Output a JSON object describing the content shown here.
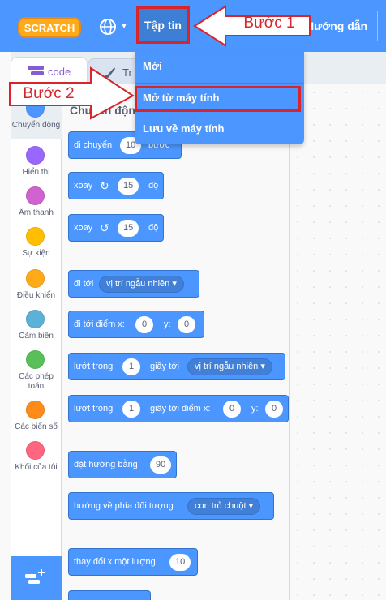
{
  "menubar": {
    "logo_text": "SCRATCH",
    "globe_icon": "globe-icon",
    "file_menu_label": "Tập tin",
    "help_menu_label": "Hướng dẫn"
  },
  "dropdown": {
    "items": [
      "Mới",
      "Mở từ máy tính",
      "Lưu về máy tính"
    ]
  },
  "callouts": {
    "step1": "Bước 1",
    "step2": "Bước 2"
  },
  "tabs": {
    "code_label": "code",
    "costume_label": "Tr"
  },
  "palette": {
    "section_title": "Chuyển động"
  },
  "categories": [
    {
      "label": "Chuyển động",
      "color": "#4c97ff"
    },
    {
      "label": "Hiển thị",
      "color": "#9966ff"
    },
    {
      "label": "Âm thanh",
      "color": "#cf63cf"
    },
    {
      "label": "Sự kiện",
      "color": "#ffbf00"
    },
    {
      "label": "Điều khiển",
      "color": "#ffab19"
    },
    {
      "label": "Cảm biến",
      "color": "#5cb1d6"
    },
    {
      "label": "Các phép toán",
      "color": "#59c059"
    },
    {
      "label": "Các biến số",
      "color": "#ff8c1a"
    },
    {
      "label": "Khối của tôi",
      "color": "#ff6680"
    }
  ],
  "blocks": {
    "move": {
      "text": "di chuyển",
      "value": "10",
      "unit": "bước"
    },
    "turn_right": {
      "text": "xoay",
      "value": "15",
      "unit": "độ"
    },
    "turn_left": {
      "text": "xoay",
      "value": "15",
      "unit": "độ"
    },
    "goto": {
      "text": "đi tới",
      "option": "vị trí ngẫu nhiên"
    },
    "goto_xy": {
      "text": "đi tới điểm x:",
      "x": "0",
      "ylabel": "y:",
      "y": "0"
    },
    "glide": {
      "text": "lướt trong",
      "secs": "1",
      "mid": "giây tới",
      "option": "vị trí ngẫu nhiên"
    },
    "glide_xy": {
      "text": "lướt trong",
      "secs": "1",
      "mid": "giây tới điểm x:",
      "x": "0",
      "ylabel": "y:",
      "y": "0"
    },
    "point_dir": {
      "text": "đặt hướng bằng",
      "value": "90"
    },
    "point_towards": {
      "text": "hướng về phía đối tượng",
      "option": "con trỏ chuột"
    },
    "change_x": {
      "text": "thay đổi x một lượng",
      "value": "10"
    }
  },
  "colors": {
    "accent": "#4c97ff",
    "highlight": "#d9242b"
  }
}
